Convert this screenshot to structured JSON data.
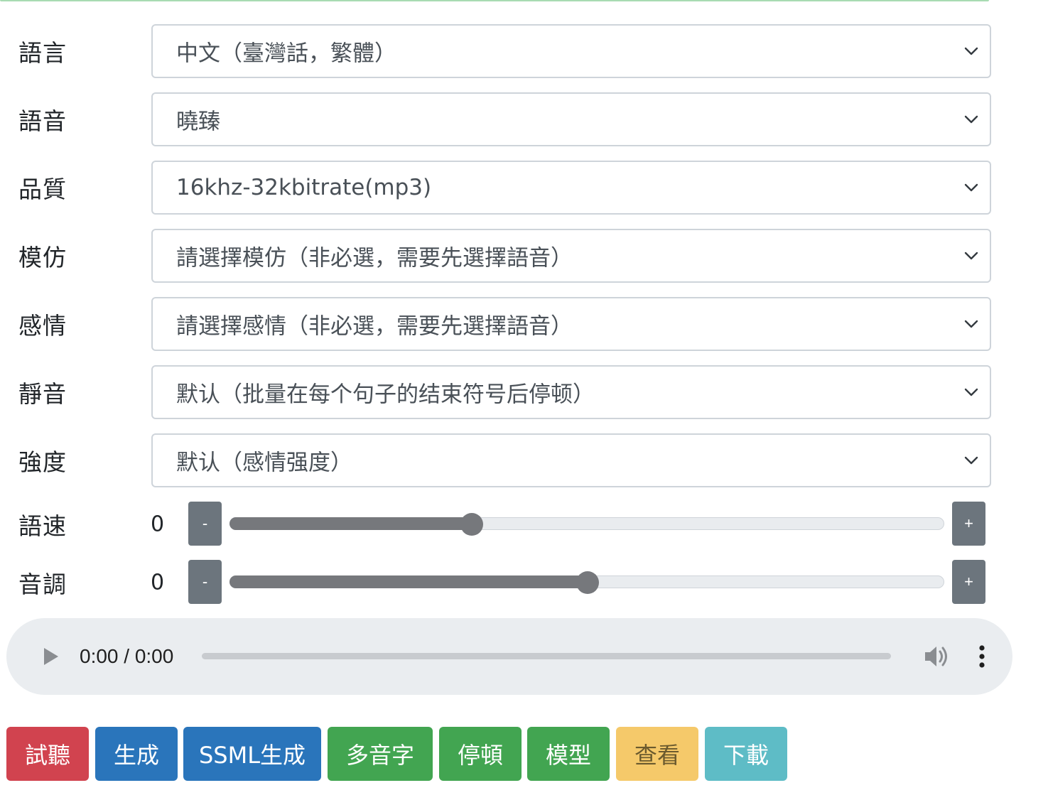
{
  "form": {
    "rows": [
      {
        "label": "語言",
        "value": "中文（臺灣話，繁體）"
      },
      {
        "label": "語音",
        "value": "曉臻"
      },
      {
        "label": "品質",
        "value": "16khz-32kbitrate(mp3)"
      },
      {
        "label": "模仿",
        "value": "請選擇模仿（非必選，需要先選擇語音）"
      },
      {
        "label": "感情",
        "value": "請選擇感情（非必選，需要先選擇語音）"
      },
      {
        "label": "靜音",
        "value": "默认（批量在每个句子的结束符号后停顿）"
      },
      {
        "label": "強度",
        "value": "默认（感情强度）"
      }
    ],
    "sliders": [
      {
        "label": "語速",
        "value": "0",
        "minus": "-",
        "plus": "+",
        "fraction": 0.338
      },
      {
        "label": "音調",
        "value": "0",
        "minus": "-",
        "plus": "+",
        "fraction": 0.5
      }
    ]
  },
  "audio": {
    "time": "0:00 / 0:00",
    "progress": 0,
    "play_icon": "play-icon",
    "volume_icon": "volume-icon",
    "menu_icon": "more-vertical-icon"
  },
  "actions": {
    "buttons": [
      {
        "label": "試聽",
        "color": "#d1434f",
        "text_color": "#ffffff"
      },
      {
        "label": "生成",
        "color": "#2a75bb",
        "text_color": "#ffffff"
      },
      {
        "label": "SSML生成",
        "color": "#2a75bb",
        "text_color": "#ffffff"
      },
      {
        "label": "多音字",
        "color": "#42a551",
        "text_color": "#ffffff"
      },
      {
        "label": "停頓",
        "color": "#42a551",
        "text_color": "#ffffff"
      },
      {
        "label": "模型",
        "color": "#42a551",
        "text_color": "#ffffff"
      },
      {
        "label": "查看",
        "color": "#f5c96a",
        "text_color": "#6b5a2e"
      },
      {
        "label": "下載",
        "color": "#5ebcc6",
        "text_color": "#ffffff"
      }
    ]
  }
}
